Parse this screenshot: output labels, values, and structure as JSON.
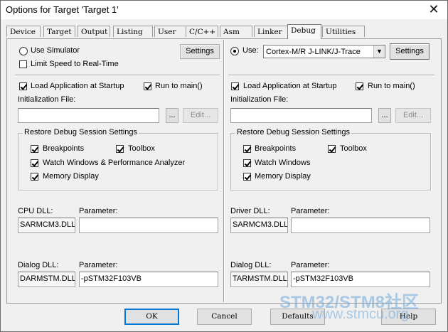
{
  "window": {
    "title": "Options for Target 'Target 1'",
    "close_glyph": "✕"
  },
  "tabs": [
    {
      "label": "Device"
    },
    {
      "label": "Target"
    },
    {
      "label": "Output"
    },
    {
      "label": "Listing"
    },
    {
      "label": "User"
    },
    {
      "label": "C/C++"
    },
    {
      "label": "Asm"
    },
    {
      "label": "Linker"
    },
    {
      "label": "Debug",
      "active": true
    },
    {
      "label": "Utilities"
    }
  ],
  "left": {
    "use_simulator": {
      "label": "Use Simulator",
      "checked": false
    },
    "limit_speed": {
      "label": "Limit Speed to Real-Time",
      "checked": false
    },
    "settings_label": "Settings",
    "load_app": {
      "label": "Load Application at Startup",
      "checked": true
    },
    "run_to_main": {
      "label": "Run to main()",
      "checked": true
    },
    "init_file_label": "Initialization File:",
    "init_file_value": "",
    "browse_label": "...",
    "edit_label": "Edit...",
    "restore_group": {
      "title": "Restore Debug Session Settings",
      "breakpoints": {
        "label": "Breakpoints",
        "checked": true
      },
      "toolbox": {
        "label": "Toolbox",
        "checked": true
      },
      "watch": {
        "label": "Watch Windows & Performance Analyzer",
        "checked": true
      },
      "memory": {
        "label": "Memory Display",
        "checked": true
      }
    },
    "dll1": {
      "label": "CPU DLL:",
      "value": "SARMCM3.DLL",
      "param_label": "Parameter:",
      "param_value": ""
    },
    "dll2": {
      "label": "Dialog DLL:",
      "value": "DARMSTM.DLL",
      "param_label": "Parameter:",
      "param_value": "-pSTM32F103VB"
    }
  },
  "right": {
    "use": {
      "label": "Use:",
      "checked": true
    },
    "driver_select": "Cortex-M/R J-LINK/J-Trace",
    "select_arrow": "▼",
    "settings_label": "Settings",
    "load_app": {
      "label": "Load Application at Startup",
      "checked": true
    },
    "run_to_main": {
      "label": "Run to main()",
      "checked": true
    },
    "init_file_label": "Initialization File:",
    "init_file_value": "",
    "browse_label": "...",
    "edit_label": "Edit...",
    "restore_group": {
      "title": "Restore Debug Session Settings",
      "breakpoints": {
        "label": "Breakpoints",
        "checked": true
      },
      "toolbox": {
        "label": "Toolbox",
        "checked": true
      },
      "watch": {
        "label": "Watch Windows",
        "checked": true
      },
      "memory": {
        "label": "Memory Display",
        "checked": true
      }
    },
    "dll1": {
      "label": "Driver DLL:",
      "value": "SARMCM3.DLL",
      "param_label": "Parameter:",
      "param_value": ""
    },
    "dll2": {
      "label": "Dialog DLL:",
      "value": "TARMSTM.DLL",
      "param_label": "Parameter:",
      "param_value": "-pSTM32F103VB"
    }
  },
  "buttons": {
    "ok": "OK",
    "cancel": "Cancel",
    "defaults": "Defaults",
    "help": "Help"
  },
  "watermark": {
    "line1": "STM32/STM8社区",
    "line2": "www.stmcu.org"
  }
}
